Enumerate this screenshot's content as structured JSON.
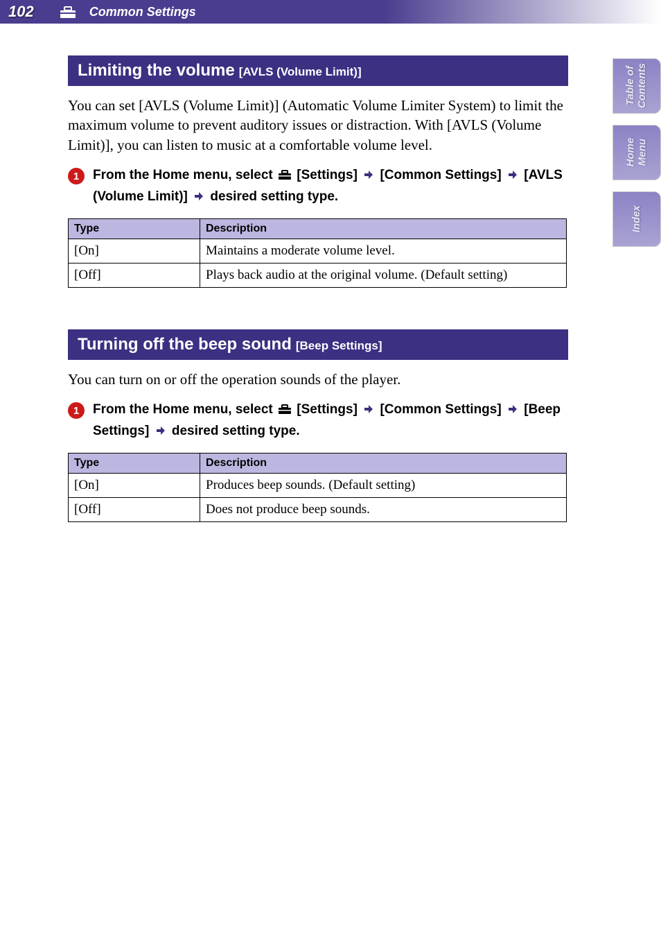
{
  "header": {
    "page_number": "102",
    "title": "Common Settings"
  },
  "section1": {
    "heading_main": "Limiting the volume",
    "heading_sub": "[AVLS (Volume Limit)]",
    "body": "You can set [AVLS (Volume Limit)] (Automatic Volume Limiter System) to limit the maximum volume to prevent auditory issues or distraction. With [AVLS (Volume Limit)], you can listen to music at a comfortable volume level.",
    "step_num": "1",
    "step_pre": "From the Home menu, select",
    "step_a": "[Settings]",
    "step_b": "[Common Settings]",
    "step_c": "[AVLS (Volume Limit)]",
    "step_end": "desired setting type.",
    "th1": "Type",
    "th2": "Description",
    "rows": [
      {
        "type": "[On]",
        "desc": "Maintains a moderate volume level."
      },
      {
        "type": "[Off]",
        "desc": "Plays back audio at the original volume. (Default setting)"
      }
    ]
  },
  "section2": {
    "heading_main": "Turning off the beep sound",
    "heading_sub": "[Beep Settings]",
    "body": "You can turn on or off the operation sounds of the player.",
    "step_num": "1",
    "step_pre": "From the Home menu, select",
    "step_a": "[Settings]",
    "step_b": "[Common Settings]",
    "step_c": "[Beep Settings]",
    "step_end": "desired setting type.",
    "th1": "Type",
    "th2": "Description",
    "rows": [
      {
        "type": "[On]",
        "desc": "Produces beep sounds. (Default setting)"
      },
      {
        "type": "[Off]",
        "desc": "Does not produce beep sounds."
      }
    ]
  },
  "side_tabs": {
    "toc_l1": "Table of",
    "toc_l2": "Contents",
    "home_l1": "Home",
    "home_l2": "Menu",
    "index": "Index"
  }
}
